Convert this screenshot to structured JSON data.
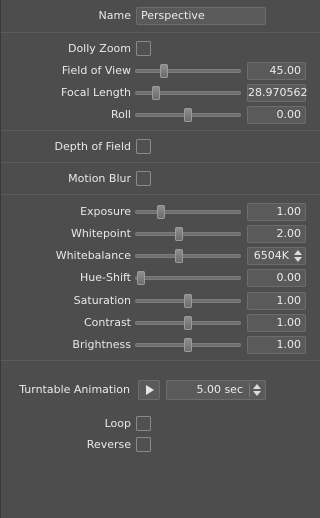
{
  "camera": {
    "name_label": "Name",
    "name_value": "Perspective",
    "dolly_zoom_label": "Dolly Zoom",
    "field_of_view": {
      "label": "Field of View",
      "value": "45.00",
      "slider": 0.26
    },
    "focal_length": {
      "label": "Focal Length",
      "value": "28.970562",
      "slider": 0.17
    },
    "roll": {
      "label": "Roll",
      "value": "0.00",
      "slider": 0.5
    }
  },
  "depth_of_field_label": "Depth of Field",
  "motion_blur_label": "Motion Blur",
  "image": {
    "exposure": {
      "label": "Exposure",
      "value": "1.00",
      "slider": 0.22
    },
    "whitepoint": {
      "label": "Whitepoint",
      "value": "2.00",
      "slider": 0.41
    },
    "whitebalance": {
      "label": "Whitebalance",
      "value": "6504K",
      "slider": 0.41
    },
    "hue_shift": {
      "label": "Hue-Shift",
      "value": "0.00",
      "slider": 0.02
    },
    "saturation": {
      "label": "Saturation",
      "value": "1.00",
      "slider": 0.5
    },
    "contrast": {
      "label": "Contrast",
      "value": "1.00",
      "slider": 0.5
    },
    "brightness": {
      "label": "Brightness",
      "value": "1.00",
      "slider": 0.5
    }
  },
  "turntable": {
    "label": "Turntable Animation",
    "duration": "5.00 sec",
    "loop_label": "Loop",
    "reverse_label": "Reverse"
  }
}
